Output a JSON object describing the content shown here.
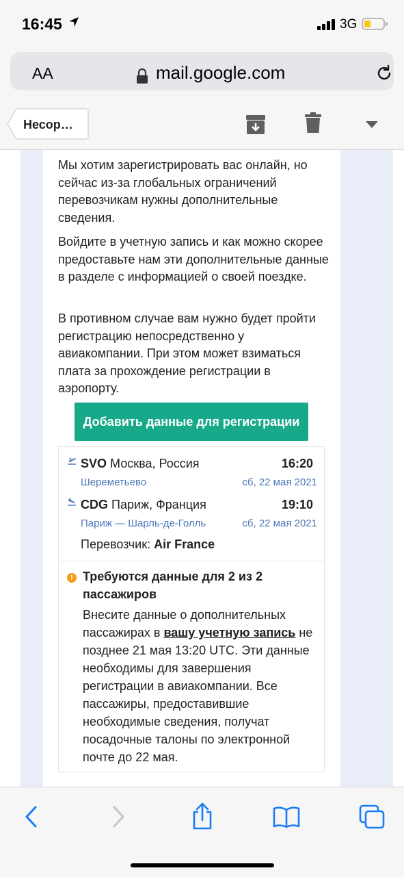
{
  "status_bar": {
    "time": "16:45",
    "network": "3G"
  },
  "address_bar": {
    "text_size_label": "AA",
    "url": "mail.google.com"
  },
  "toolbar": {
    "back_label": "Несор…"
  },
  "email": {
    "paragraphs": [
      "Мы хотим зарегистрировать вас онлайн, но сейчас из-за глобальных ограничений перевозчикам нужны дополнительные сведения.",
      "Войдите в учетную запись и как можно скорее предоставьте нам эти дополнительные данные в разделе с информацией о своей поездке.",
      "В противном случае вам нужно будет пройти регистрацию непосредственно у авиакомпании. При этом может взиматься плата за прохождение регистрации в аэропорту."
    ],
    "cta_label": "Добавить данные для регистрации",
    "flight": {
      "departure": {
        "code": "SVO",
        "city": "Москва, Россия",
        "time": "16:20",
        "airport": "Шереметьево",
        "date": "сб, 22 мая 2021"
      },
      "arrival": {
        "code": "CDG",
        "city": "Париж, Франция",
        "time": "19:10",
        "airport": "Париж — Шарль-де-Голль",
        "date": "сб, 22 мая 2021"
      },
      "carrier_label": "Перевозчик:",
      "carrier": "Air France"
    },
    "notice": {
      "icon": "!",
      "title": "Требуются данные для 2 из 2 пассажиров",
      "body_before": "Внесите данные о дополнительных пассажирах в ",
      "link": "вашу учетную запись",
      "body_after": " не позднее 21 мая 13:20 UTC. Эти данные необходимы для завершения регистрации в авиакомпании. Все пассажиры, предоставившие необходимые сведения, получат посадочные талоны по электронной почте до 22 мая."
    }
  },
  "colors": {
    "accent": "#18a88a",
    "link_blue": "#1a7cf5",
    "sub_blue": "#4a76b8",
    "warning": "#f39c12"
  }
}
